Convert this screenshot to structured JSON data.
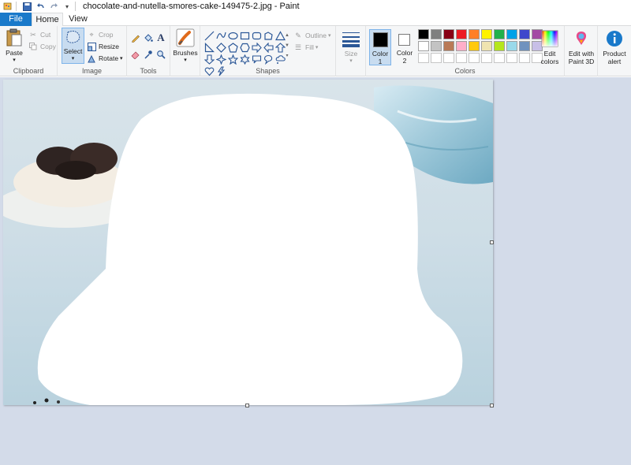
{
  "window": {
    "title": "chocolate-and-nutella-smores-cake-149475-2.jpg - Paint"
  },
  "quick_access": {
    "icons": [
      "paint-app-icon",
      "save-icon",
      "undo-icon",
      "redo-icon",
      "customize-dropdown-icon"
    ]
  },
  "tabs": [
    {
      "label": "File",
      "active": false
    },
    {
      "label": "Home",
      "active": true
    },
    {
      "label": "View",
      "active": false
    }
  ],
  "clipboard": {
    "paste_label": "Paste",
    "cut_label": "Cut",
    "copy_label": "Copy",
    "group_label": "Clipboard"
  },
  "image": {
    "select_label": "Select",
    "crop_label": "Crop",
    "resize_label": "Resize",
    "rotate_label": "Rotate",
    "group_label": "Image"
  },
  "tools": {
    "group_label": "Tools",
    "items": [
      "pencil-icon",
      "fill-bucket-icon",
      "text-icon",
      "eraser-icon",
      "color-picker-icon",
      "magnifier-icon"
    ]
  },
  "brushes": {
    "label": "Brushes"
  },
  "shapes": {
    "group_label": "Shapes",
    "outline_label": "Outline",
    "fill_label": "Fill",
    "items": [
      "line",
      "curve",
      "oval",
      "rectangle",
      "rounded-rectangle",
      "polygon",
      "triangle",
      "right-triangle",
      "diamond",
      "pentagon",
      "hexagon",
      "right-arrow",
      "left-arrow",
      "up-arrow",
      "down-arrow",
      "four-point-star",
      "five-point-star",
      "six-point-star",
      "rounded-callout",
      "oval-callout",
      "cloud-callout",
      "heart",
      "lightning"
    ]
  },
  "size": {
    "label": "Size"
  },
  "colors": {
    "group_label": "Colors",
    "color1_label": "Color\n1",
    "color1_line1": "Color",
    "color1_line2": "1",
    "color2_line1": "Color",
    "color2_line2": "2",
    "color1_value": "#000000",
    "color2_value": "#ffffff",
    "palette_row1": [
      "#000000",
      "#7f7f7f",
      "#880015",
      "#ed1c24",
      "#ff7f27",
      "#fff200",
      "#22b14c",
      "#00a2e8",
      "#3f48cc",
      "#a349a4"
    ],
    "palette_row2": [
      "#ffffff",
      "#c3c3c3",
      "#b97a57",
      "#ffaec9",
      "#ffc90e",
      "#efe4b0",
      "#b5e61d",
      "#99d9ea",
      "#7092be",
      "#c8bfe7"
    ],
    "edit_colors_line1": "Edit",
    "edit_colors_line2": "colors",
    "paint3d_line1": "Edit with",
    "paint3d_line2": "Paint 3D",
    "product_alert_line1": "Product",
    "product_alert_line2": "alert"
  },
  "canvas": {
    "image_colors": {
      "background": "#cfe0ea",
      "blob": "#ffffff",
      "cloth": "#9fc9da",
      "bowl": "#f1ece4",
      "cookie": "#2f2422"
    }
  }
}
